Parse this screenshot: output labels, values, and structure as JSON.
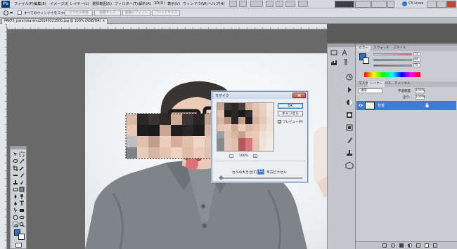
{
  "app": {
    "logo": "Ps",
    "menu": [
      "ファイル(F)",
      "編集(E)",
      "イメージ(I)",
      "レイヤー(L)",
      "選択範囲(S)",
      "フィルター(T)",
      "解析(A)",
      "3D(D)",
      "表示(V)",
      "ウィンドウ(W)",
      "ヘルプ(H)"
    ],
    "cs_live": "CS Live▾"
  },
  "options_bar": {
    "scroll_all_label": "すべてのウィンドウをスクロール",
    "buttons": [
      "ピクセル等倍",
      "画面サイズ",
      "画面にフィット",
      "プリントサイズ"
    ]
  },
  "document": {
    "tab_title": "PAKT5_panchisarenu20140321500.jpg @ 100% (RGB/8#) ×"
  },
  "panels": {
    "color_tabs": [
      "カラー",
      "スウォッチ",
      "スタイル"
    ],
    "color_values": [
      "73",
      "49",
      "75"
    ],
    "layer_tabs": [
      "マスク",
      "レイヤー",
      "パス",
      "チャンネル"
    ],
    "blend_mode": "通常",
    "opacity_label": "不透明度:",
    "opacity_value": "100%",
    "fill_label": "塗り:",
    "fill_value": "100%",
    "layer_name": "背景"
  },
  "dialog": {
    "title": "モザイク",
    "ok_label": "OK",
    "cancel_label": "キャンセル",
    "preview_label": "プレビュー(P)",
    "preview_checked": true,
    "zoom_out": "-",
    "zoom_in": "+",
    "zoom_level": "100%",
    "cell_size_label": "セルの大きさ(C) :",
    "cell_size_value": "11",
    "cell_size_unit": "平方ピクセル"
  },
  "colors": {
    "foreground": "#2f6fc4",
    "background": "#ffffff",
    "accent": "#3d7bd4"
  },
  "icons": [
    "zoom-icon",
    "hand-icon",
    "marquee-icon",
    "lasso-icon",
    "crop-icon",
    "eyedropper-icon",
    "brush-icon",
    "eraser-icon",
    "type-icon",
    "pen-icon",
    "eye-icon",
    "lock-icon"
  ]
}
